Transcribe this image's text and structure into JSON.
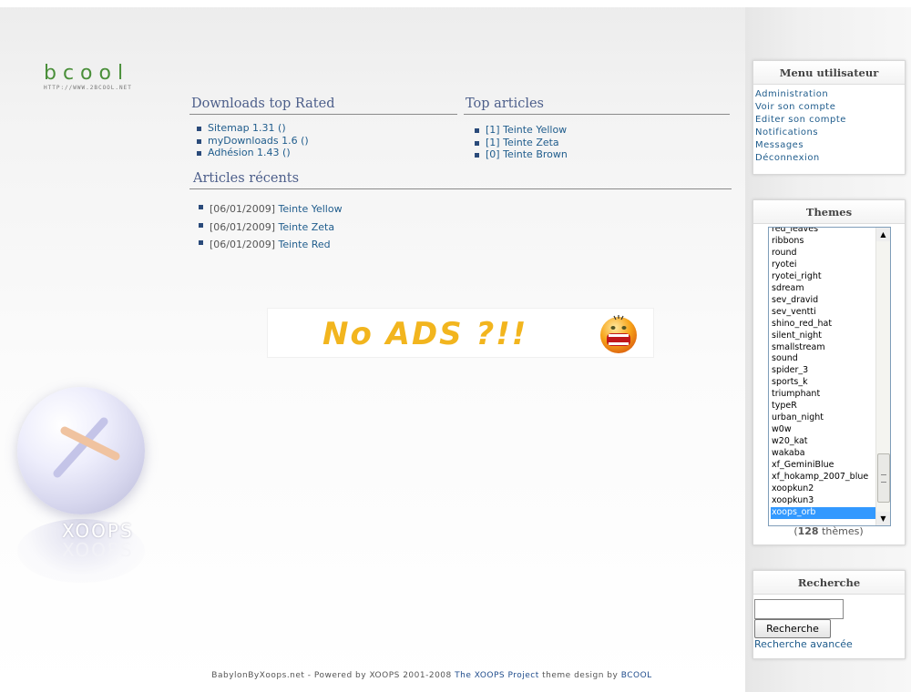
{
  "logo": {
    "text": "bcool",
    "subtext": "HTTP://WWW.2BCOOL.NET"
  },
  "downloads_block": {
    "title": "Downloads top Rated",
    "items": [
      {
        "name": "Sitemap 1.31",
        "suffix": " ()"
      },
      {
        "name": "myDownloads 1.6",
        "suffix": " ()"
      },
      {
        "name": "Adhésion 1.43",
        "suffix": " ()"
      }
    ]
  },
  "top_articles_block": {
    "title": "Top articles",
    "items": [
      {
        "count": "[1]",
        "title": "Teinte Yellow"
      },
      {
        "count": "[1]",
        "title": "Teinte Zeta"
      },
      {
        "count": "[0]",
        "title": "Teinte Brown"
      }
    ]
  },
  "recent_articles_block": {
    "title": "Articles récents",
    "items": [
      {
        "date": "[06/01/2009]",
        "title": "Teinte Yellow"
      },
      {
        "date": "[06/01/2009]",
        "title": "Teinte Zeta"
      },
      {
        "date": "[06/01/2009]",
        "title": "Teinte Red"
      }
    ]
  },
  "ad_banner": {
    "text": "No ADS ?!!"
  },
  "orb": {
    "brand": "XOOPS"
  },
  "user_menu": {
    "title": "Menu utilisateur",
    "items": [
      "Administration",
      "Voir son compte",
      "Editer son compte",
      "Notifications",
      "Messages",
      "Déconnexion"
    ]
  },
  "themes": {
    "title": "Themes",
    "options": [
      "red_leaves",
      "ribbons",
      "round",
      "ryotei",
      "ryotei_right",
      "sdream",
      "sev_dravid",
      "sev_ventti",
      "shino_red_hat",
      "silent_night",
      "smallstream",
      "sound",
      "spider_3",
      "sports_k",
      "triumphant",
      "typeR",
      "urban_night",
      "w0w",
      "w20_kat",
      "wakaba",
      "xf_GeminiBlue",
      "xf_hokamp_2007_blue",
      "xoopkun2",
      "xoopkun3",
      "xoops_orb"
    ],
    "selected": "xoops_orb",
    "count": "128",
    "count_label": "thèmes"
  },
  "search": {
    "title": "Recherche",
    "input_value": "",
    "button_label": "Recherche",
    "advanced_label": "Recherche avancée"
  },
  "footer": {
    "prefix": "BabylonByXoops.net - Powered by XOOPS 2001-2008 ",
    "project_link": "The XOOPS Project",
    "middle": " theme design by ",
    "designer_link": "BCOOL"
  }
}
